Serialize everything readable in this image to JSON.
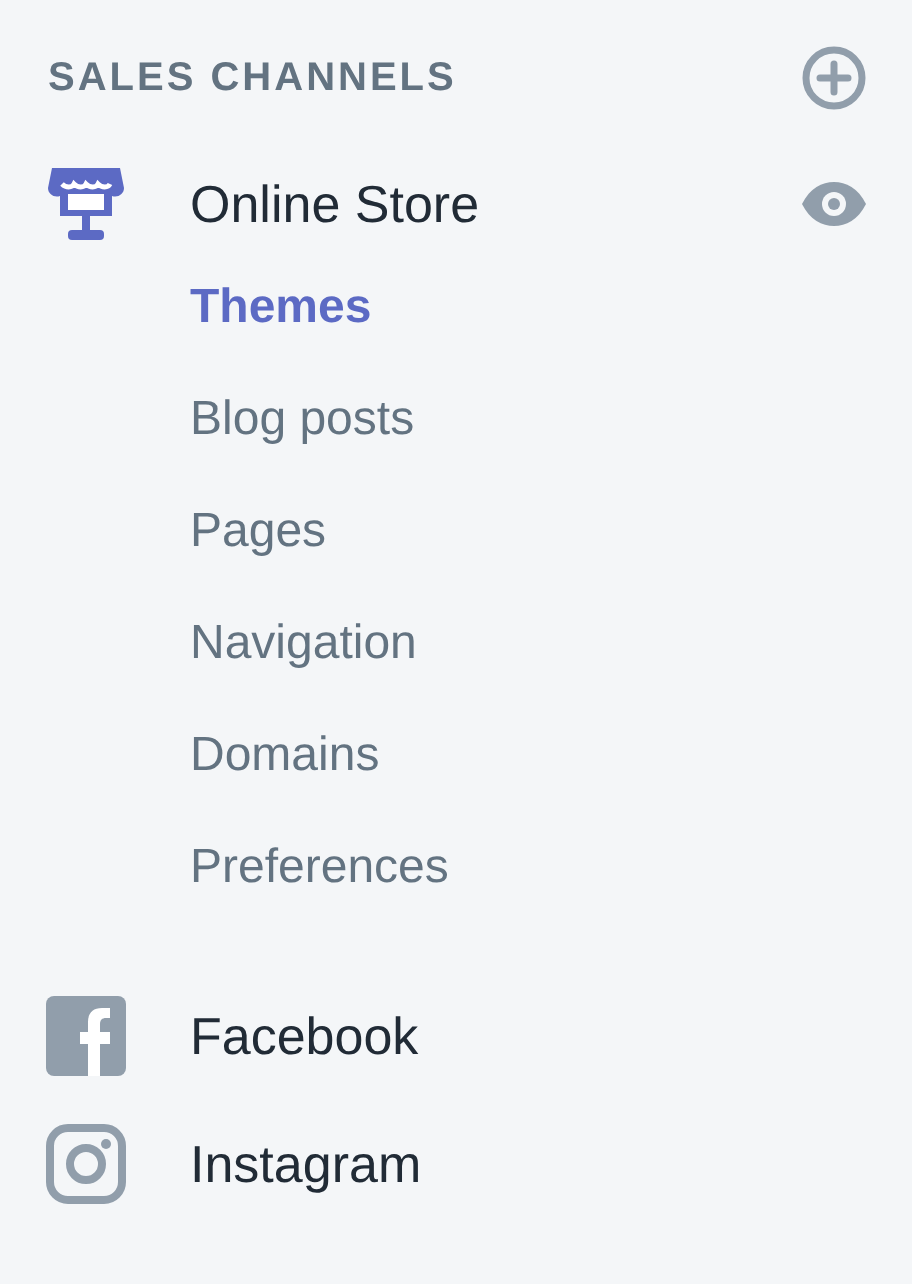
{
  "section": {
    "title": "SALES CHANNELS"
  },
  "channels": [
    {
      "kind": "store",
      "label": "Online Store",
      "selected": true,
      "children": [
        {
          "label": "Themes",
          "selected": true
        },
        {
          "label": "Blog posts",
          "selected": false
        },
        {
          "label": "Pages",
          "selected": false
        },
        {
          "label": "Navigation",
          "selected": false
        },
        {
          "label": "Domains",
          "selected": false
        },
        {
          "label": "Preferences",
          "selected": false
        }
      ]
    },
    {
      "kind": "facebook",
      "label": "Facebook",
      "selected": false
    },
    {
      "kind": "instagram",
      "label": "Instagram",
      "selected": false
    }
  ]
}
